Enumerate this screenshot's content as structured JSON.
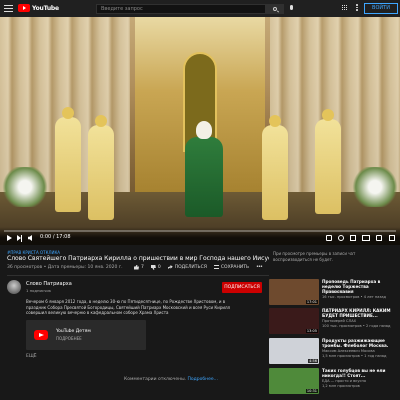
{
  "header": {
    "logo_text": "YouTube",
    "search_placeholder": "Введите запрос",
    "signin_label": "ВОЙТИ"
  },
  "player": {
    "time": "0:00 / 17:08",
    "progress_fraction": 0.0
  },
  "video": {
    "hashtag": "#ПРАВ КРИСТА ОТКЛИКА",
    "title": "Слово Святейшего Патриарха Кирилла о пришествии в мир Господа нашего Иисуса Христа.",
    "meta": "36 просмотров • Дата премьеры: 10 янв. 2020 г.",
    "likes": "7",
    "dislikes": "0",
    "share_label": "ПОДЕЛИТЬСЯ",
    "save_label": "СОХРАНИТЬ"
  },
  "channel": {
    "name": "Слово Патриарха",
    "subscribers": "1 подписчик",
    "subscribe_label": "ПОДПИСАТЬСЯ"
  },
  "description": {
    "text": "Вечером 6 января 2012 года, в неделю 30-ю по Пятидесятнице, по Рождестве Христовом, и в праздник Собора Пресвятой Богородицы, Святейший Патриарх Московский и всея Руси Кирилл совершил великую вечерню в кафедральном соборе Храма Христа",
    "promo_title": "YouTube Детям",
    "promo_more": "ПОДРОБНЕЕ",
    "ellipsis": "ЕЩЁ"
  },
  "comments": {
    "disabled_text": "Комментарии отключены.",
    "more_link": "Подробнее..."
  },
  "sidebar": {
    "chat_note": "При просмотре премьеры в записи чат воспроизводиться не будет.",
    "recommendations": [
      {
        "title": "Проповедь Патриарха в неделю Торжества Православия",
        "channel": "МЕТАНОЙЯ",
        "meta": "16 тыс. просмотров • 4 лет назад",
        "duration": "17:01",
        "thumb_color": "#6e4a2e"
      },
      {
        "title": "ПАТРИАРХ КИРИЛЛ: КАКИМ БУДЕТ ПРИШЕСТВИЕ...",
        "channel": "Протоиерей СЛАХ",
        "meta": "100 тыс. просмотров • 2 года назад",
        "duration": "13:05",
        "thumb_color": "#3a1a1a"
      },
      {
        "title": "Продукты разжижающие тромбы. Флеболог Москва.",
        "channel": "Максим Алексеевич Москва",
        "meta": "1,5 млн просмотров • 1 год назад",
        "duration": "4:56",
        "thumb_color": "#cfd2d8"
      },
      {
        "title": "Таких голубцов вы не ели никогда!! Стоят...",
        "channel": "ЕДА — просто и вкусно",
        "meta": "1,2 млн просмотров",
        "duration": "10:31",
        "thumb_color": "#4f8a3a"
      }
    ]
  }
}
